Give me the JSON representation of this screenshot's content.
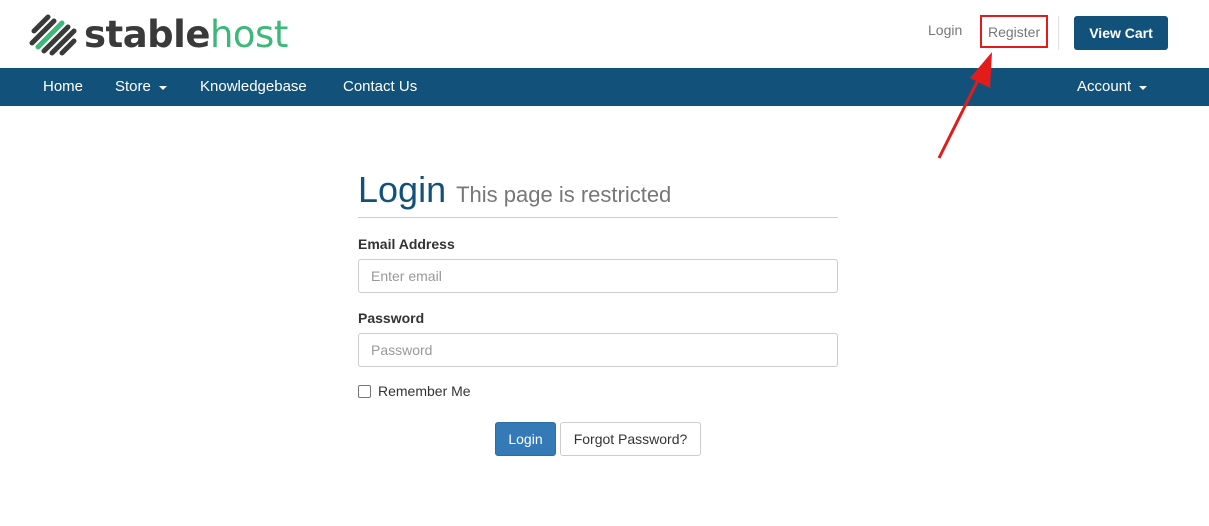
{
  "brand": {
    "name_part1": "stable",
    "name_part2": "host",
    "color_dark": "#3a3a3a",
    "color_green": "#3cb878",
    "logo_icon": "stripes-logo-icon"
  },
  "header": {
    "login_link": "Login",
    "register_link": "Register",
    "view_cart_button": "View Cart"
  },
  "nav": {
    "items": [
      {
        "label": "Home",
        "has_dropdown": false
      },
      {
        "label": "Store",
        "has_dropdown": true
      },
      {
        "label": "Knowledgebase",
        "has_dropdown": false
      },
      {
        "label": "Contact Us",
        "has_dropdown": false
      }
    ],
    "account": {
      "label": "Account",
      "has_dropdown": true
    },
    "color": "#12527a"
  },
  "annotation": {
    "highlight_color": "#e31b1b"
  },
  "login_form": {
    "title": "Login",
    "subtitle": "This page is restricted",
    "email_label": "Email Address",
    "email_placeholder": "Enter email",
    "email_value": "",
    "password_label": "Password",
    "password_placeholder": "Password",
    "password_value": "",
    "remember_label": "Remember Me",
    "remember_checked": false,
    "login_button": "Login",
    "forgot_button": "Forgot Password?",
    "primary_color": "#337ab7"
  }
}
